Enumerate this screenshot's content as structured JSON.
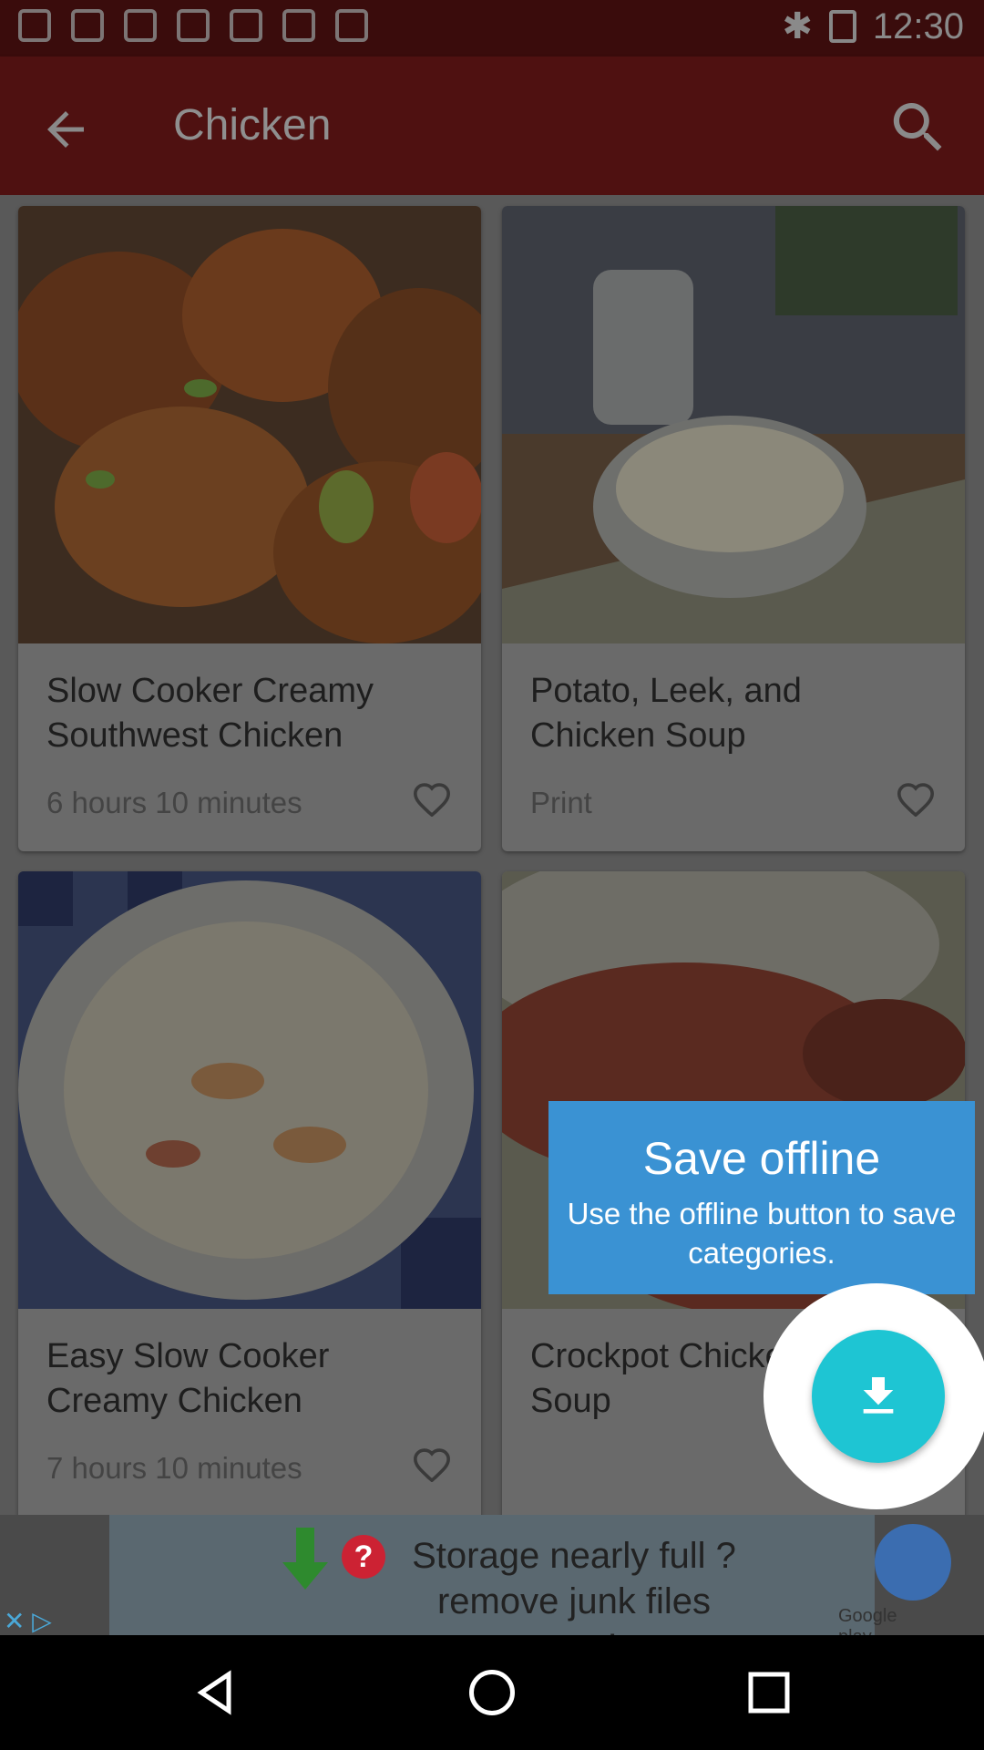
{
  "status_bar": {
    "time": "12:30"
  },
  "header": {
    "title": "Chicken"
  },
  "recipes": [
    {
      "title": "Slow Cooker Creamy Southwest Chicken",
      "meta": "6 hours 10 minutes"
    },
    {
      "title": "Potato, Leek, and Chicken Soup",
      "meta": "Print"
    },
    {
      "title": "Easy Slow Cooker Creamy Chicken",
      "meta": "7 hours 10 minutes"
    },
    {
      "title": "Crockpot Chicken Pot Pie Soup",
      "meta": ""
    }
  ],
  "tooltip": {
    "title": "Save offline",
    "body": "Use the offline button to save categories."
  },
  "fab": {
    "icon": "download-icon"
  },
  "ad": {
    "line1": "Storage nearly full ?",
    "line2": "remove junk files now !",
    "help": "?",
    "store": "Google play"
  },
  "colors": {
    "app_bar": "#4f1111",
    "accent": "#1ec5d3",
    "tooltip": "#3a92d3"
  }
}
